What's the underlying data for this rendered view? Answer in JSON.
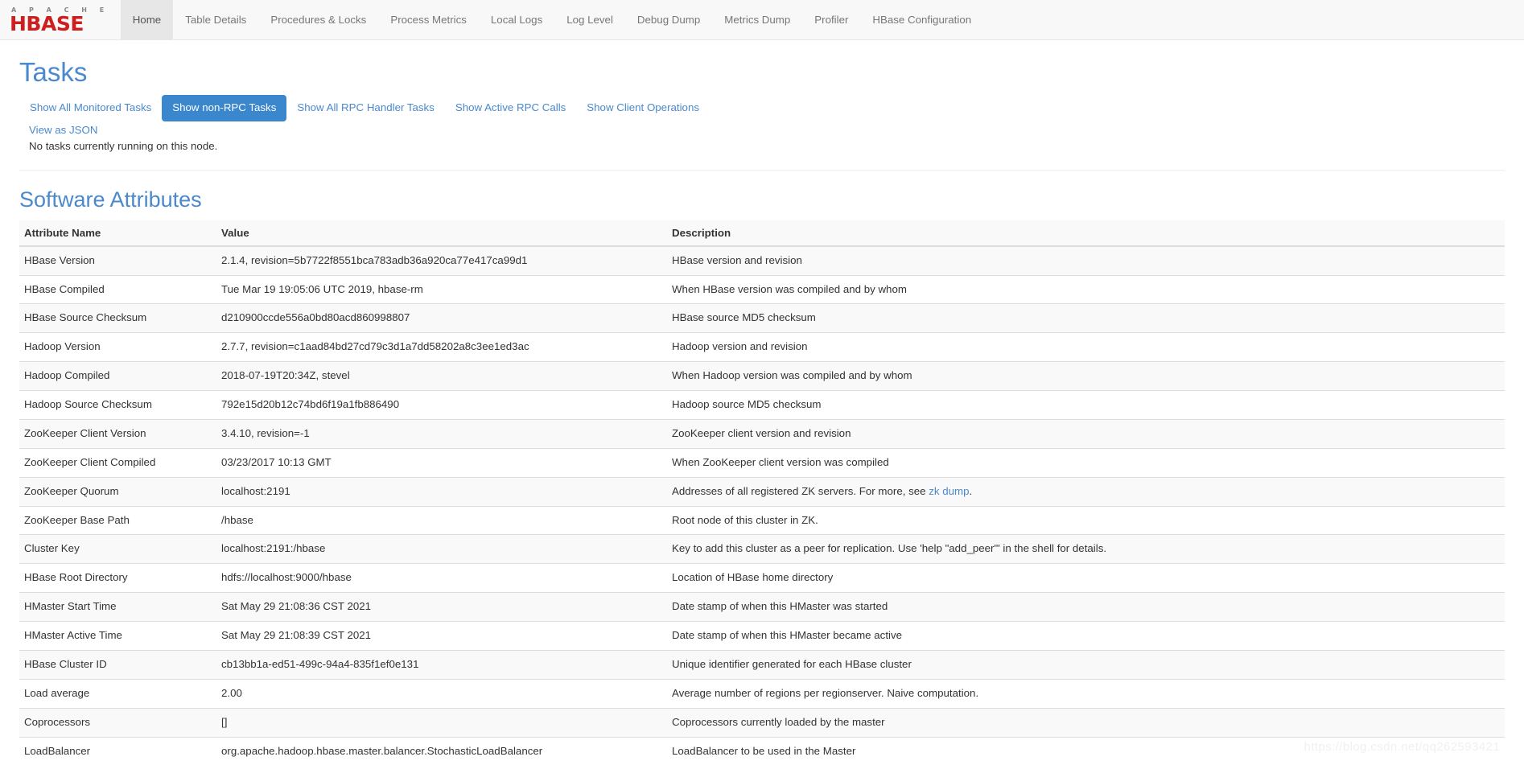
{
  "navbar": {
    "brand": {
      "apache_text": "A P A C H E",
      "hbase_text": "HBASE"
    },
    "items": [
      {
        "label": "Home",
        "active": true
      },
      {
        "label": "Table Details",
        "active": false
      },
      {
        "label": "Procedures & Locks",
        "active": false
      },
      {
        "label": "Process Metrics",
        "active": false
      },
      {
        "label": "Local Logs",
        "active": false
      },
      {
        "label": "Log Level",
        "active": false
      },
      {
        "label": "Debug Dump",
        "active": false
      },
      {
        "label": "Metrics Dump",
        "active": false
      },
      {
        "label": "Profiler",
        "active": false
      },
      {
        "label": "HBase Configuration",
        "active": false
      }
    ]
  },
  "tasks": {
    "heading": "Tasks",
    "filters": [
      {
        "label": "Show All Monitored Tasks",
        "active": false
      },
      {
        "label": "Show non-RPC Tasks",
        "active": true
      },
      {
        "label": "Show All RPC Handler Tasks",
        "active": false
      },
      {
        "label": "Show Active RPC Calls",
        "active": false
      },
      {
        "label": "Show Client Operations",
        "active": false
      }
    ],
    "json_link": "View as JSON",
    "empty_message": "No tasks currently running on this node."
  },
  "software_attributes": {
    "heading": "Software Attributes",
    "columns": [
      "Attribute Name",
      "Value",
      "Description"
    ],
    "rows": [
      {
        "name": "HBase Version",
        "value": "2.1.4, revision=5b7722f8551bca783adb36a920ca77e417ca99d1",
        "description": "HBase version and revision"
      },
      {
        "name": "HBase Compiled",
        "value": "Tue Mar 19 19:05:06 UTC 2019, hbase-rm",
        "description": "When HBase version was compiled and by whom"
      },
      {
        "name": "HBase Source Checksum",
        "value": "d210900ccde556a0bd80acd860998807",
        "description": "HBase source MD5 checksum"
      },
      {
        "name": "Hadoop Version",
        "value": "2.7.7, revision=c1aad84bd27cd79c3d1a7dd58202a8c3ee1ed3ac",
        "description": "Hadoop version and revision"
      },
      {
        "name": "Hadoop Compiled",
        "value": "2018-07-19T20:34Z, stevel",
        "description": "When Hadoop version was compiled and by whom"
      },
      {
        "name": "Hadoop Source Checksum",
        "value": "792e15d20b12c74bd6f19a1fb886490",
        "description": "Hadoop source MD5 checksum"
      },
      {
        "name": "ZooKeeper Client Version",
        "value": "3.4.10, revision=-1",
        "description": "ZooKeeper client version and revision"
      },
      {
        "name": "ZooKeeper Client Compiled",
        "value": "03/23/2017 10:13 GMT",
        "description": "When ZooKeeper client version was compiled"
      },
      {
        "name": "ZooKeeper Quorum",
        "value": "localhost:2191",
        "description": "Addresses of all registered ZK servers. For more, see ",
        "description_link": "zk dump",
        "description_suffix": "."
      },
      {
        "name": "ZooKeeper Base Path",
        "value": "/hbase",
        "description": "Root node of this cluster in ZK."
      },
      {
        "name": "Cluster Key",
        "value": "localhost:2191:/hbase",
        "description": "Key to add this cluster as a peer for replication. Use 'help \"add_peer\"' in the shell for details."
      },
      {
        "name": "HBase Root Directory",
        "value": "hdfs://localhost:9000/hbase",
        "description": "Location of HBase home directory"
      },
      {
        "name": "HMaster Start Time",
        "value": "Sat May 29 21:08:36 CST 2021",
        "description": "Date stamp of when this HMaster was started"
      },
      {
        "name": "HMaster Active Time",
        "value": "Sat May 29 21:08:39 CST 2021",
        "description": "Date stamp of when this HMaster became active"
      },
      {
        "name": "HBase Cluster ID",
        "value": "cb13bb1a-ed51-499c-94a4-835f1ef0e131",
        "description": "Unique identifier generated for each HBase cluster"
      },
      {
        "name": "Load average",
        "value": "2.00",
        "description": "Average number of regions per regionserver. Naive computation."
      },
      {
        "name": "Coprocessors",
        "value": "[]",
        "description": "Coprocessors currently loaded by the master"
      },
      {
        "name": "LoadBalancer",
        "value": "org.apache.hadoop.hbase.master.balancer.StochasticLoadBalancer",
        "description": "LoadBalancer to be used in the Master"
      }
    ]
  },
  "watermark": "https://blog.csdn.net/qq262593421",
  "colors": {
    "brand_red": "#cc1f1f",
    "heading_blue": "#4a89cd",
    "active_button": "#3a87cd",
    "navbar_bg": "#f8f8f8"
  }
}
